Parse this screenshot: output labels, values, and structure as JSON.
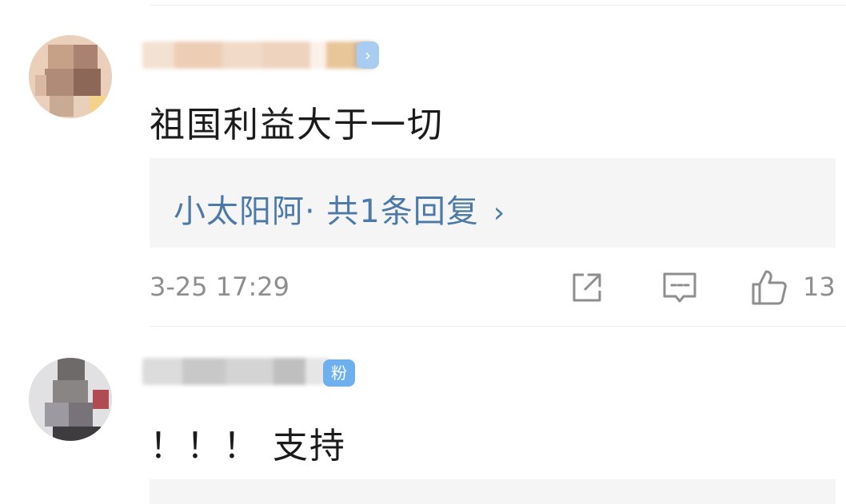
{
  "comments": [
    {
      "badge": "›",
      "text": "祖国利益大于一切",
      "reply_link": "小太阳阿· 共1条回复",
      "reply_chevron": "›",
      "time": "3-25 17:29",
      "likes": "13"
    },
    {
      "badge": "粉",
      "text": "！！！ 支持"
    }
  ],
  "icons": {
    "share": "share-icon",
    "comment": "comment-icon",
    "like": "thumbs-up-icon"
  },
  "colors": {
    "reply_link": "#4c7aa8",
    "badge": "#6eb0ee",
    "meta_text": "#8e8e8e",
    "reply_bg": "#f5f5f5"
  }
}
